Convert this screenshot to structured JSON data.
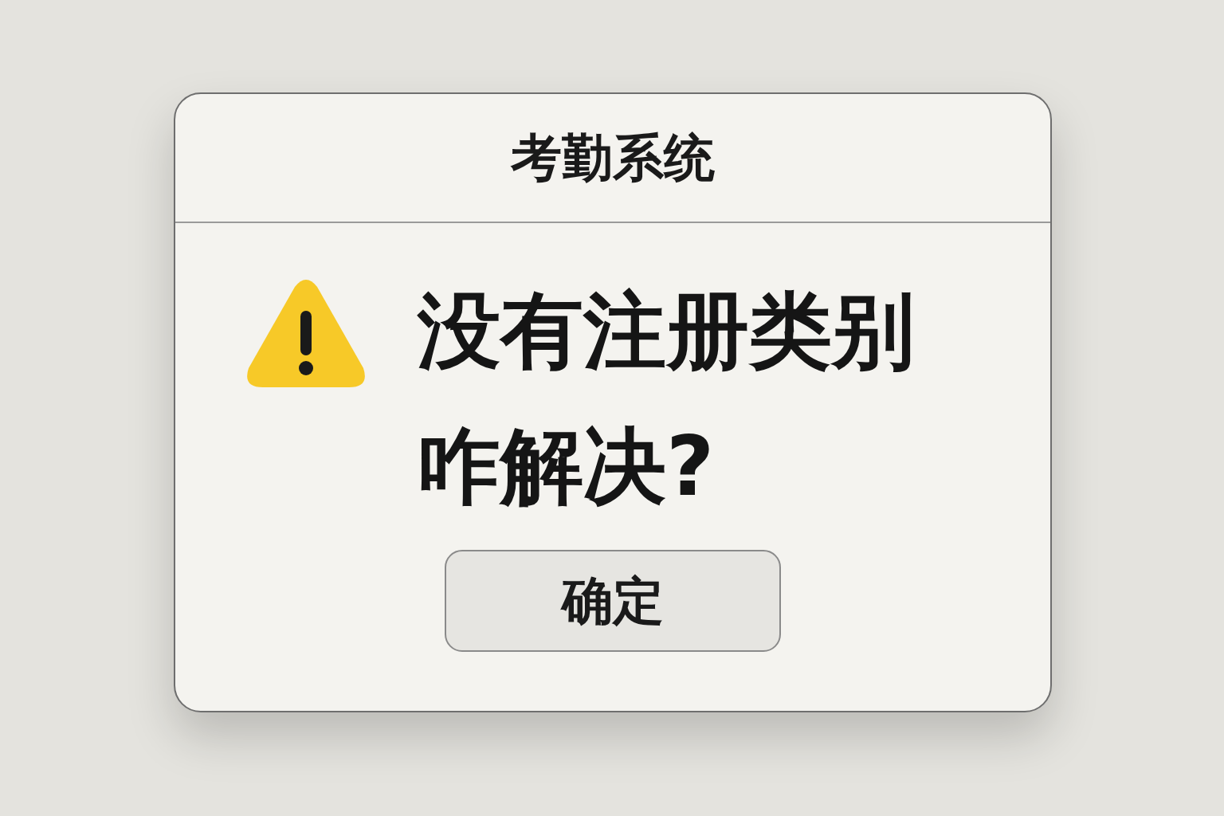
{
  "dialog": {
    "title": "考勤系统",
    "message": "没有注册类别咋解决?",
    "icon": {
      "kind": "warning"
    },
    "buttons": [
      {
        "label": "确定"
      }
    ]
  }
}
